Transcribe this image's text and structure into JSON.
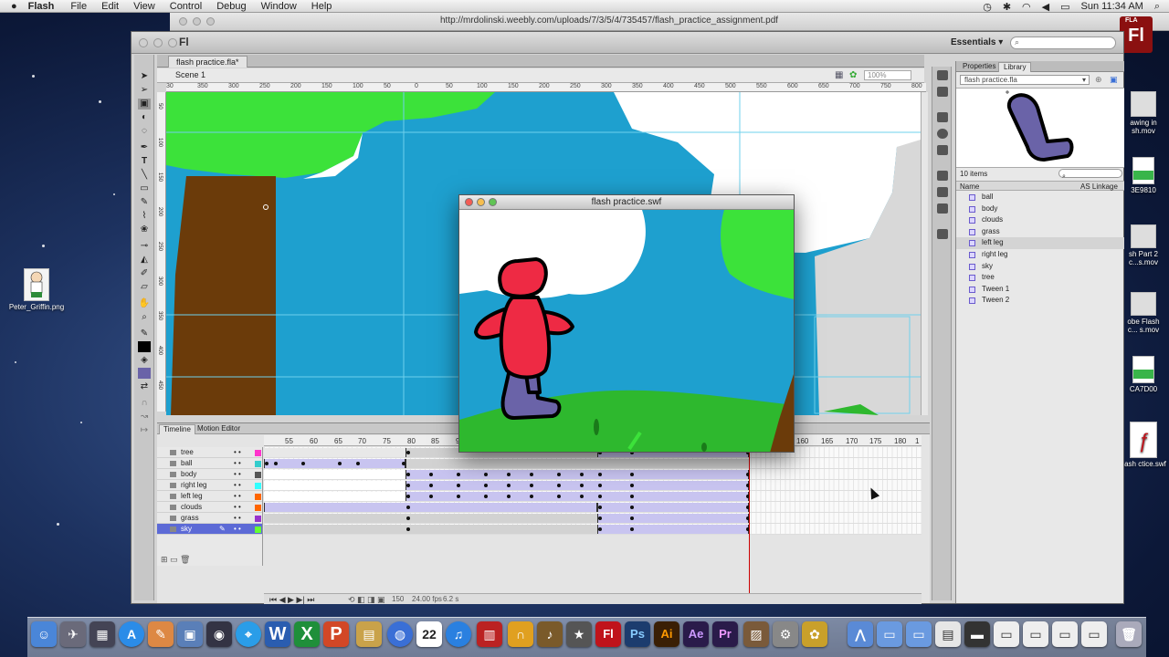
{
  "menubar": {
    "app": "Flash",
    "items": [
      "File",
      "Edit",
      "View",
      "Control",
      "Debug",
      "Window",
      "Help"
    ],
    "clock": "Sun 11:34 AM"
  },
  "browser": {
    "url": "http://mrdolinski.weebly.com/uploads/7/3/5/4/735457/flash_practice_assignment.pdf"
  },
  "fla_badge": {
    "small": "FLA",
    "big": "Fl"
  },
  "app": {
    "logo": "Fl",
    "workspace": "Essentials",
    "workspace_arrow": "▾"
  },
  "document": {
    "tab": "flash practice.fla*",
    "scene": "Scene 1",
    "zoom": "100%"
  },
  "ruler": {
    "top_ticks": [
      "30",
      "350",
      "300",
      "250",
      "200",
      "150",
      "100",
      "50",
      "0",
      "50",
      "100",
      "150",
      "200",
      "250",
      "300",
      "350",
      "400",
      "450",
      "500",
      "550",
      "600",
      "650",
      "700",
      "750",
      "800"
    ],
    "left_ticks": [
      "50",
      "100",
      "150",
      "200",
      "250",
      "300",
      "350",
      "400",
      "450"
    ]
  },
  "swf_window": {
    "title": "flash practice.swf"
  },
  "library": {
    "tabs": [
      "Properties",
      "Library"
    ],
    "file": "flash practice.fla",
    "item_count": "10 items",
    "col_name": "Name",
    "col_linkage": "AS Linkage",
    "items": [
      "ball",
      "body",
      "clouds",
      "grass",
      "left leg",
      "right leg",
      "sky",
      "tree",
      "Tween 1",
      "Tween 2"
    ],
    "selected": "left leg"
  },
  "timeline": {
    "tabs": [
      "Timeline",
      "Motion Editor"
    ],
    "frame_numbers": [
      "55",
      "60",
      "65",
      "70",
      "75",
      "80",
      "85",
      "90",
      "95",
      "100",
      "105",
      "110",
      "115",
      "120",
      "125",
      "130",
      "135",
      "140",
      "145",
      "150",
      "155",
      "160",
      "165",
      "170",
      "175",
      "180",
      "1"
    ],
    "layers": [
      {
        "name": "tree",
        "color": "#ff33cc"
      },
      {
        "name": "ball",
        "color": "#33cccc"
      },
      {
        "name": "body",
        "color": "#555555"
      },
      {
        "name": "right leg",
        "color": "#33ffff"
      },
      {
        "name": "left leg",
        "color": "#ff6600"
      },
      {
        "name": "clouds",
        "color": "#ff6600"
      },
      {
        "name": "grass",
        "color": "#9933cc"
      },
      {
        "name": "sky",
        "color": "#66ff33"
      }
    ],
    "selected_layer": "sky",
    "current_frame": "150",
    "fps": "24.00 fps",
    "time": "6.2 s"
  },
  "desktop_icons": [
    {
      "label": "Peter_Griffin.png"
    },
    {
      "label": "awing in sh.mov"
    },
    {
      "label": "3E9810"
    },
    {
      "label": "sh Part 2 c...s.mov"
    },
    {
      "label": "obe Flash c... s.mov"
    },
    {
      "label": "CA7D00"
    },
    {
      "label": "flash ctice.swf"
    }
  ],
  "dock": {
    "apps": [
      "Finder",
      "Launchpad",
      "Mission Control",
      "App Store",
      "Pencil",
      "Preview",
      "Photo Booth",
      "Safari",
      "Word",
      "Excel",
      "PowerPoint",
      "Notes",
      "Globe",
      "Calendar",
      "iTunes",
      "Photo",
      "Music",
      "GarageBand",
      "iMovie",
      "Flash",
      "Photoshop",
      "Illustrator",
      "After Effects",
      "Premiere",
      "Image Capture",
      "System Preferences",
      "Pineapple",
      "Applications",
      "Documents",
      "Downloads",
      "Folder",
      "Trash"
    ]
  },
  "colors": {
    "sky": "#1ea0cf",
    "grass": "#2eb82e",
    "tree_trunk": "#6b3b0a",
    "foliage": "#3ce23a",
    "character_red": "#ee2a44",
    "character_legs": "#6a63a8"
  }
}
